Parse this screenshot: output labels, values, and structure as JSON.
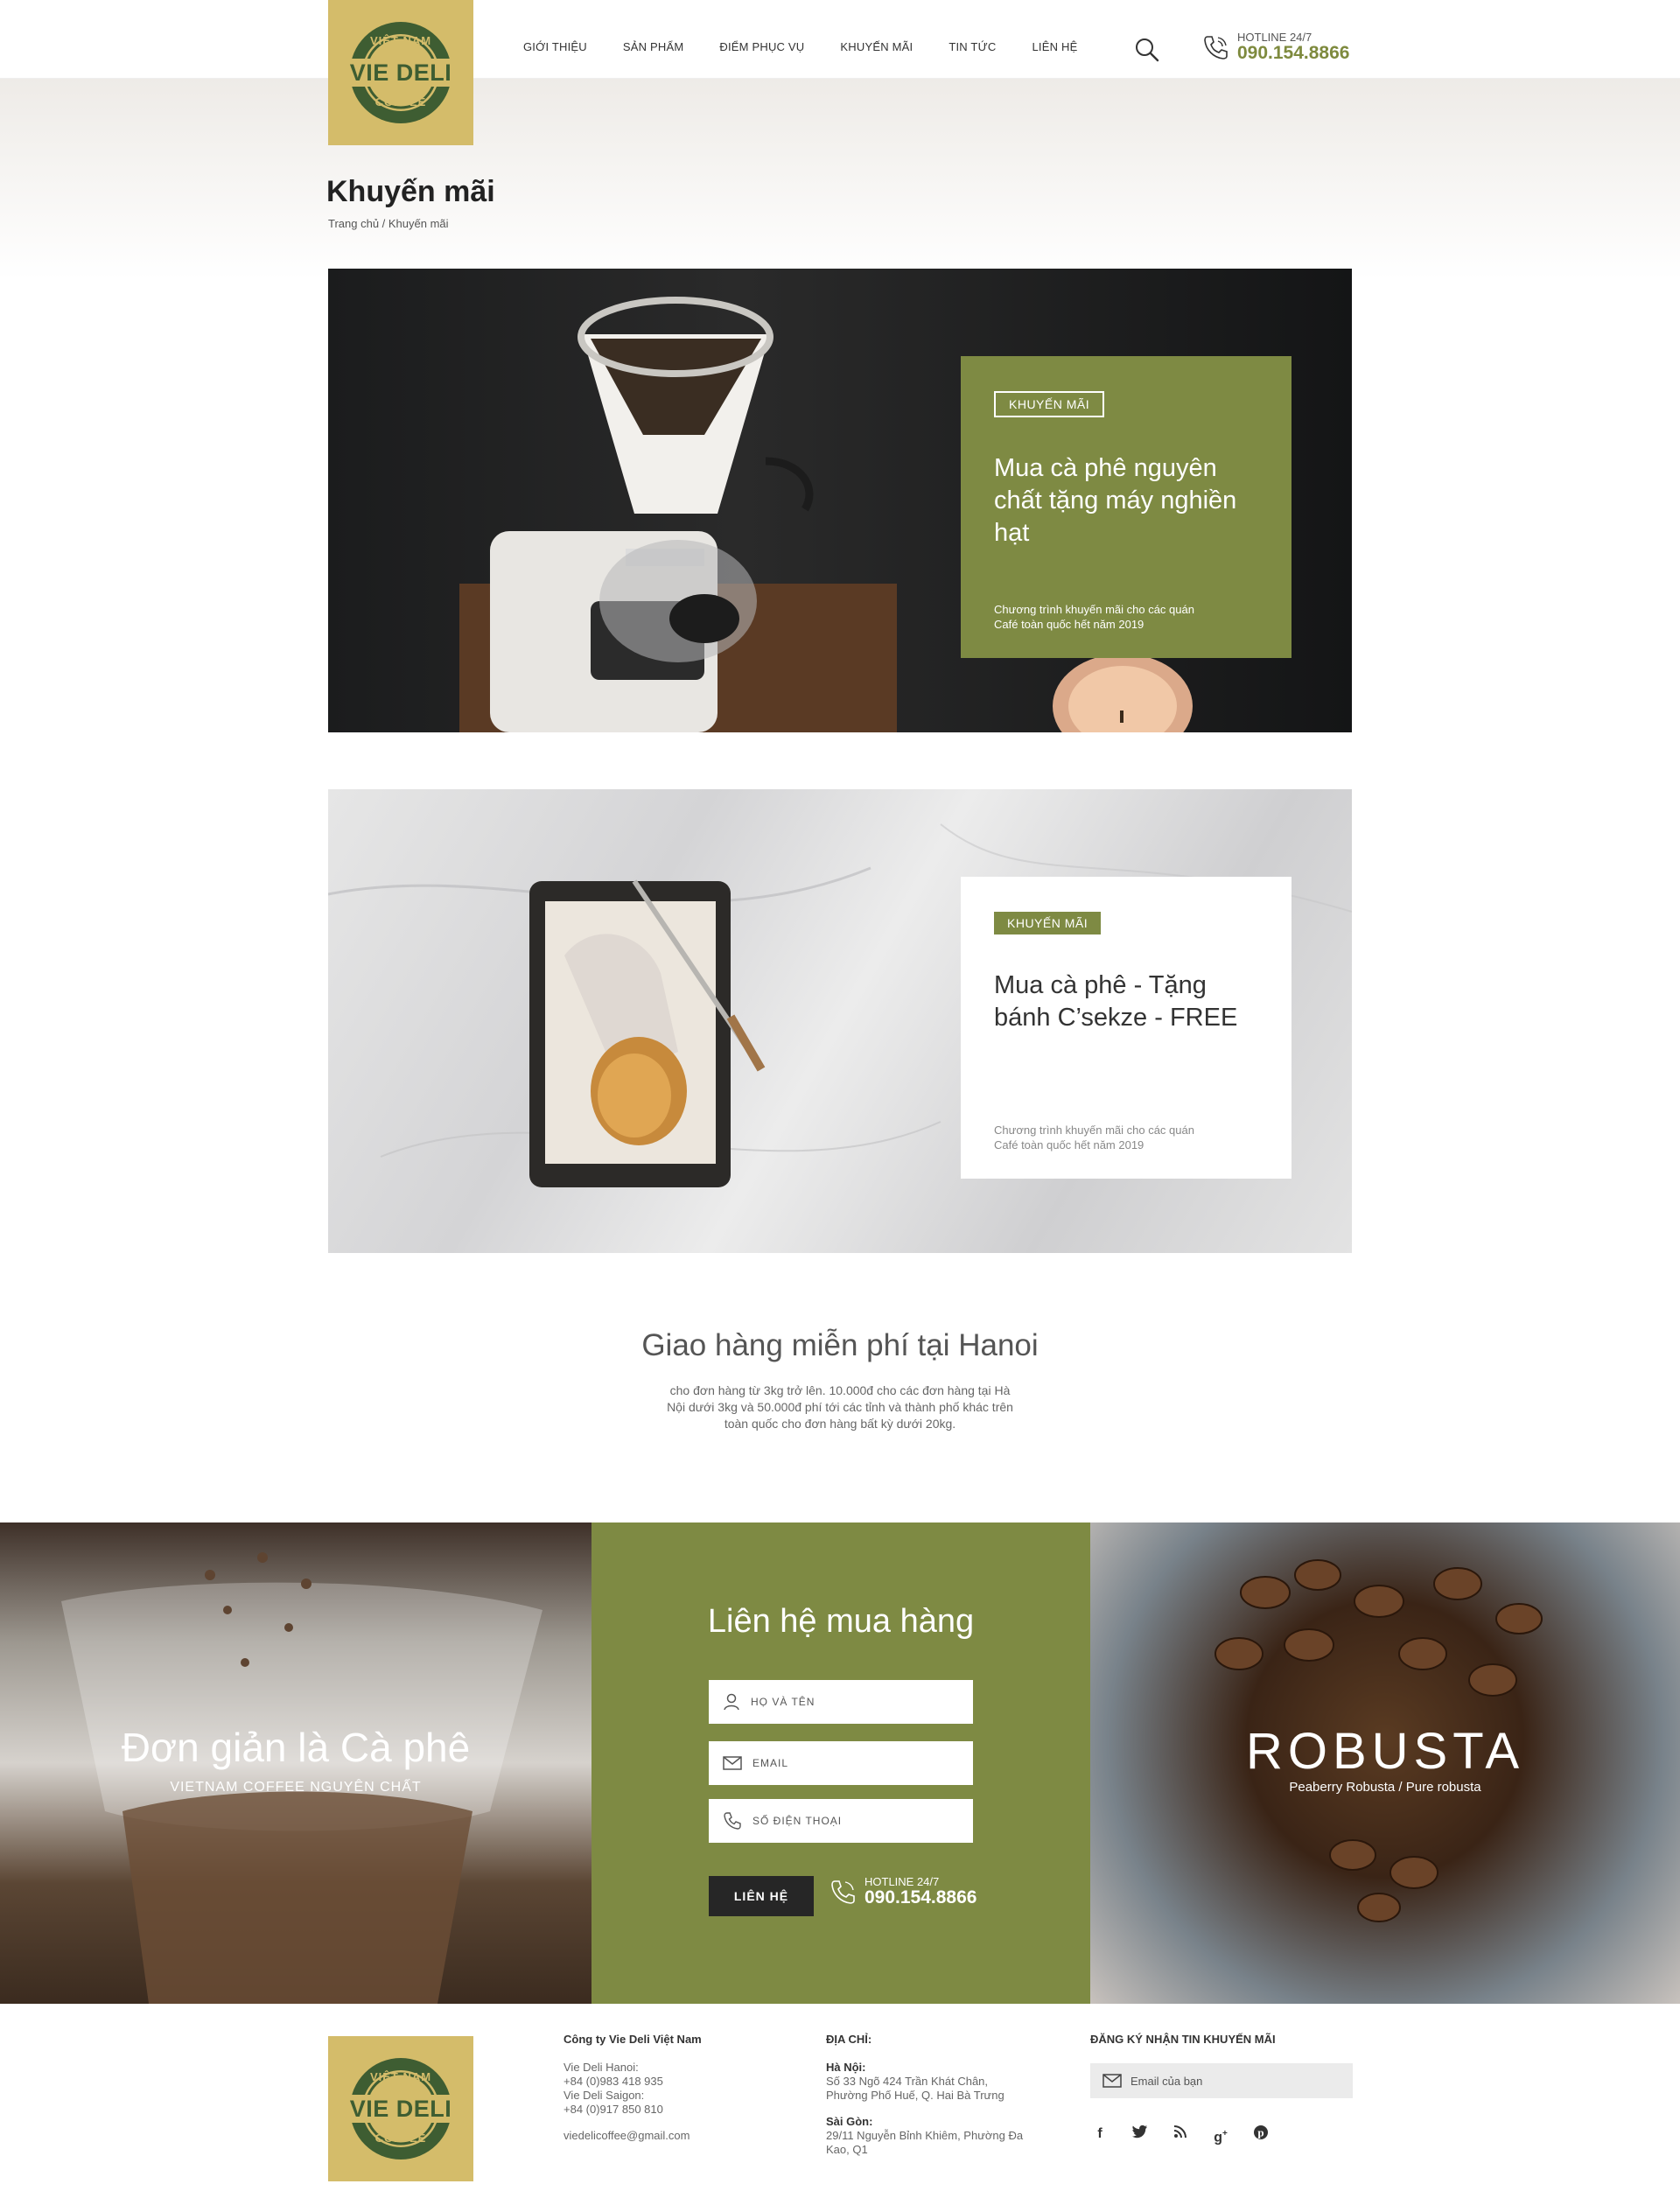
{
  "header": {
    "logo": {
      "top": "VIỆT NAM",
      "main": "VIE DELI",
      "bottom": "COFFEE"
    },
    "nav": [
      "GIỚI THIỆU",
      "SẢN PHẨM",
      "ĐIỂM PHỤC VỤ",
      "KHUYẾN MÃI",
      "TIN TỨC",
      "LIÊN HỆ"
    ],
    "hotline_label": "HOTLINE 24/7",
    "hotline_number": "090.154.8866"
  },
  "page": {
    "title": "Khuyến mãi",
    "breadcrumb": "Trang chủ / Khuyến mãi"
  },
  "promos": [
    {
      "tag": "KHUYẾN MÃI",
      "title": "Mua cà phê nguyên chất tặng máy nghiền hạt",
      "subtitle": "Chương trình khuyến mãi cho các quán Café toàn quốc hết năm 2019"
    },
    {
      "tag": "KHUYẾN MÃI",
      "title": "Mua cà phê - Tặng bánh C’sekze - FREE",
      "subtitle": "Chương trình khuyến mãi cho các quán Café toàn quốc hết năm 2019"
    }
  ],
  "delivery": {
    "title": "Giao hàng miễn phí tại Hanoi",
    "text": "cho đơn hàng từ 3kg trở lên. 10.000đ cho các đơn hàng tại Hà Nội dưới 3kg và 50.000đ phí tới các tỉnh và thành phố khác trên toàn quốc cho đơn hàng bất kỳ dưới 20kg."
  },
  "left_panel": {
    "title": "Đơn giản là Cà phê",
    "subtitle": "VIETNAM COFFEE NGUYÊN CHẤT"
  },
  "contact": {
    "title": "Liên hệ mua hàng",
    "name_placeholder": "HỌ VÀ TÊN",
    "email_placeholder": "EMAIL",
    "phone_placeholder": "SỐ ĐIỆN THOẠI",
    "submit_label": "LIÊN HỆ",
    "hotline_label": "HOTLINE 24/7",
    "hotline_number": "090.154.8866"
  },
  "right_panel": {
    "title": "ROBUSTA",
    "subtitle": "Peaberry Robusta / Pure robusta"
  },
  "footer": {
    "company": "Công ty Vie Deli Việt Nam",
    "hanoi_label": "Vie Deli Hanoi:",
    "hanoi_phone": "+84 (0)983 418 935",
    "saigon_label": "Vie Deli Saigon:",
    "saigon_phone": "+84 (0)917 850 810",
    "email": "viedelicoffee@gmail.com",
    "address_head": "ĐỊA CHỈ:",
    "hanoi_city": "Hà Nội:",
    "hanoi_addr": "Số 33 Ngõ 424 Trần Khát Chân, Phường Phố Huế, Q. Hai Bà Trưng",
    "saigon_city": "Sài Gòn:",
    "saigon_addr": "29/11 Nguyễn Bỉnh Khiêm, Phường Đa Kao, Q1",
    "newsletter_head": "ĐĂNG KÝ NHẬN TIN KHUYẾN MÃI",
    "newsletter_placeholder": "Email của bạn",
    "socials": [
      "facebook-icon",
      "twitter-icon",
      "rss-icon",
      "google-plus-icon",
      "pinterest-icon"
    ]
  },
  "colors": {
    "accent": "#7e8a43",
    "logo_bg": "#d4bc6a",
    "logo_ink": "#3e5d32",
    "dark": "#262626"
  }
}
